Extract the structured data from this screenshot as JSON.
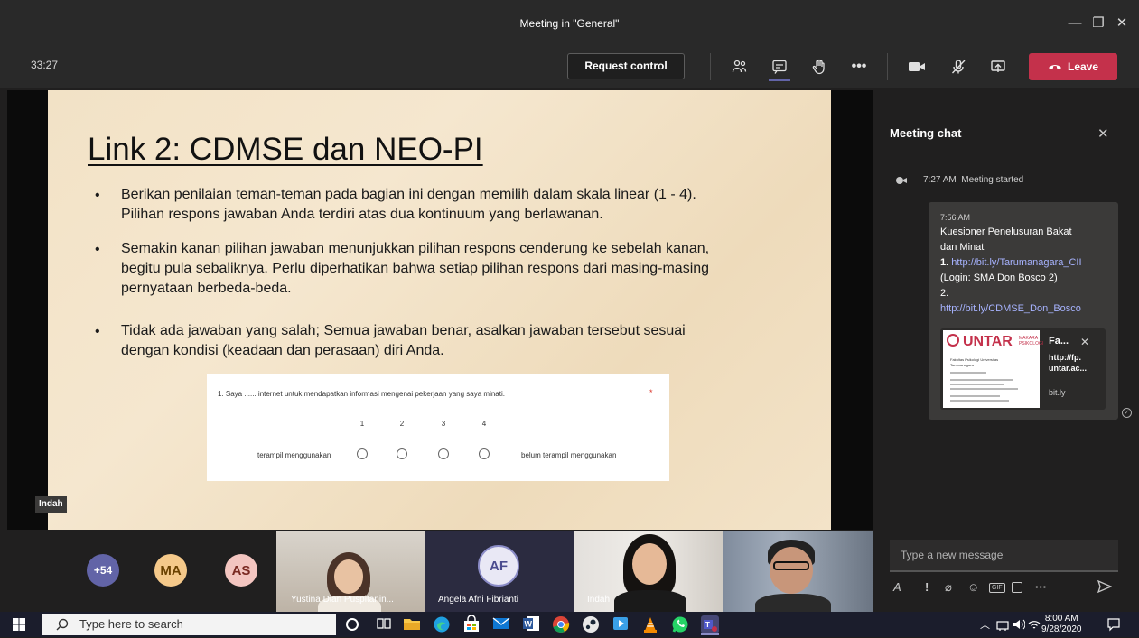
{
  "window": {
    "title": "Meeting in \"General\"",
    "minimize": "—",
    "maximize": "❐",
    "close": "✕"
  },
  "toolbar": {
    "timer": "33:27",
    "request_control": "Request control",
    "leave": "Leave"
  },
  "slide": {
    "title": "Link 2: CDMSE dan NEO-PI",
    "bullet_symbol": "•",
    "bullets": [
      [
        "Berikan penilaian teman-teman pada bagian ini dengan memilih dalam skala linear (1 - 4).",
        "Pilihan respons jawaban Anda terdiri atas dua kontinuum yang berlawanan."
      ],
      [
        "Semakin kanan pilihan jawaban menunjukkan pilihan respons cenderung ke sebelah kanan,",
        "begitu pula sebaliknya. Perlu diperhatikan bahwa setiap pilihan respons dari masing-masing",
        "pernyataan berbeda-beda."
      ],
      [
        "Tidak ada jawaban yang salah; Semua jawaban benar, asalkan jawaban tersebut sesuai",
        "dengan kondisi (keadaan dan perasaan) diri Anda."
      ]
    ],
    "form": {
      "question": "1. Saya ...... internet untuk mendapatkan informasi mengenai pekerjaan yang saya minati.",
      "required": "*",
      "scale": [
        "1",
        "2",
        "3",
        "4"
      ],
      "left_label": "terampil menggunakan",
      "right_label": "belum terampil menggunakan"
    },
    "presenter": "Indah"
  },
  "chat": {
    "title": "Meeting chat",
    "close": "✕",
    "system_time": "7:27 AM",
    "system_text": "Meeting started",
    "message": {
      "time": "7:56 AM",
      "line1": "Kuesioner Penelusuran Bakat",
      "line2": "dan Minat",
      "item1_num": "1.",
      "item1_link": "http://bit.ly/Tarumanagara_CII",
      "item1_note": "(Login: SMA Don Bosco 2)",
      "item2_num": "2.",
      "item2_link": "http://bit.ly/CDMSE_Don_Bosco"
    },
    "preview": {
      "logo": "UNTAR",
      "logo_sub": "MAKARA PSIKOLOGI",
      "thumb_line1": "Fakultas Psikologi Universitas",
      "thumb_line2": "Tarumanagara",
      "title": "Fa...",
      "close": "✕",
      "url_line1": "http://fp.",
      "url_line2": "untar.ac...",
      "domain": "bit.ly"
    },
    "compose_placeholder": "Type a new message"
  },
  "participants": {
    "overflow": "+54",
    "avatars": [
      {
        "initials": "MA",
        "bg": "#f5c98a",
        "fg": "#6b4200"
      },
      {
        "initials": "AS",
        "bg": "#f3c5c0",
        "fg": "#7a2a22"
      }
    ],
    "tiles": [
      {
        "name": "Yustina Dian Puspitanin..."
      },
      {
        "name": "Angela Afni Fibrianti",
        "initials": "AF"
      },
      {
        "name": "Indah"
      },
      {
        "name": ""
      }
    ]
  },
  "taskbar": {
    "search_placeholder": "Type here to search",
    "time": "8:00 AM",
    "date": "9/28/2020"
  },
  "colors": {
    "leave": "#c4314b",
    "accent": "#6264a7",
    "link": "#a7b3ff"
  }
}
